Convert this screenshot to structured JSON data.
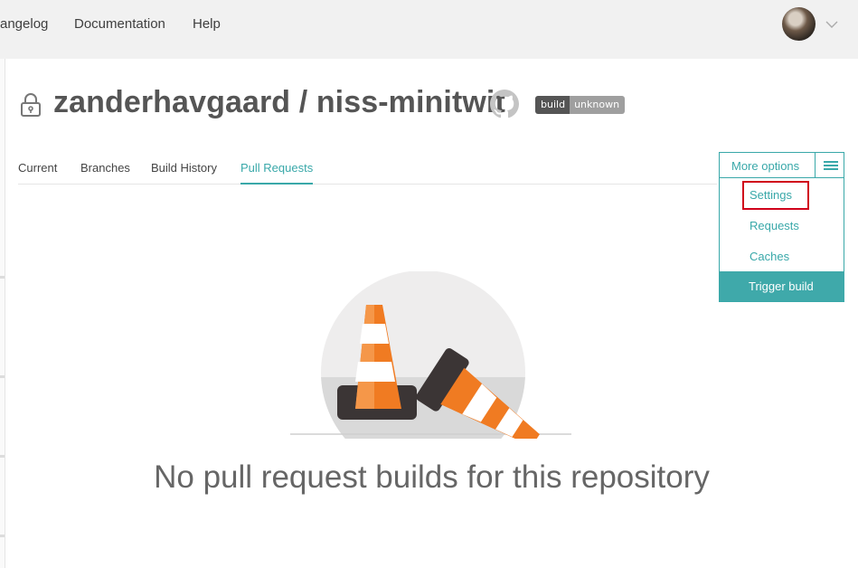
{
  "nav": {
    "changelog": "angelog",
    "documentation": "Documentation",
    "help": "Help"
  },
  "repo": {
    "owner": "zanderhavgaard",
    "separator": "/",
    "name": "niss-minitwit"
  },
  "badge": {
    "left": "build",
    "right": "unknown"
  },
  "tabs": [
    {
      "label": "Current"
    },
    {
      "label": "Branches"
    },
    {
      "label": "Build History"
    },
    {
      "label": "Pull Requests",
      "active": true
    }
  ],
  "more_options": {
    "label": "More options",
    "items": [
      {
        "label": "Settings",
        "highlighted": true
      },
      {
        "label": "Requests"
      },
      {
        "label": "Caches"
      }
    ],
    "trigger": "Trigger build"
  },
  "empty_state": {
    "message": "No pull request builds for this repository"
  },
  "icons": [
    "lock-icon",
    "github-icon",
    "hamburger-icon",
    "chevron-down-icon",
    "traffic-cones-illustration"
  ],
  "colors": {
    "accent": "#39a8a9",
    "highlight": "#d0021b",
    "cone": "#f07b22"
  }
}
